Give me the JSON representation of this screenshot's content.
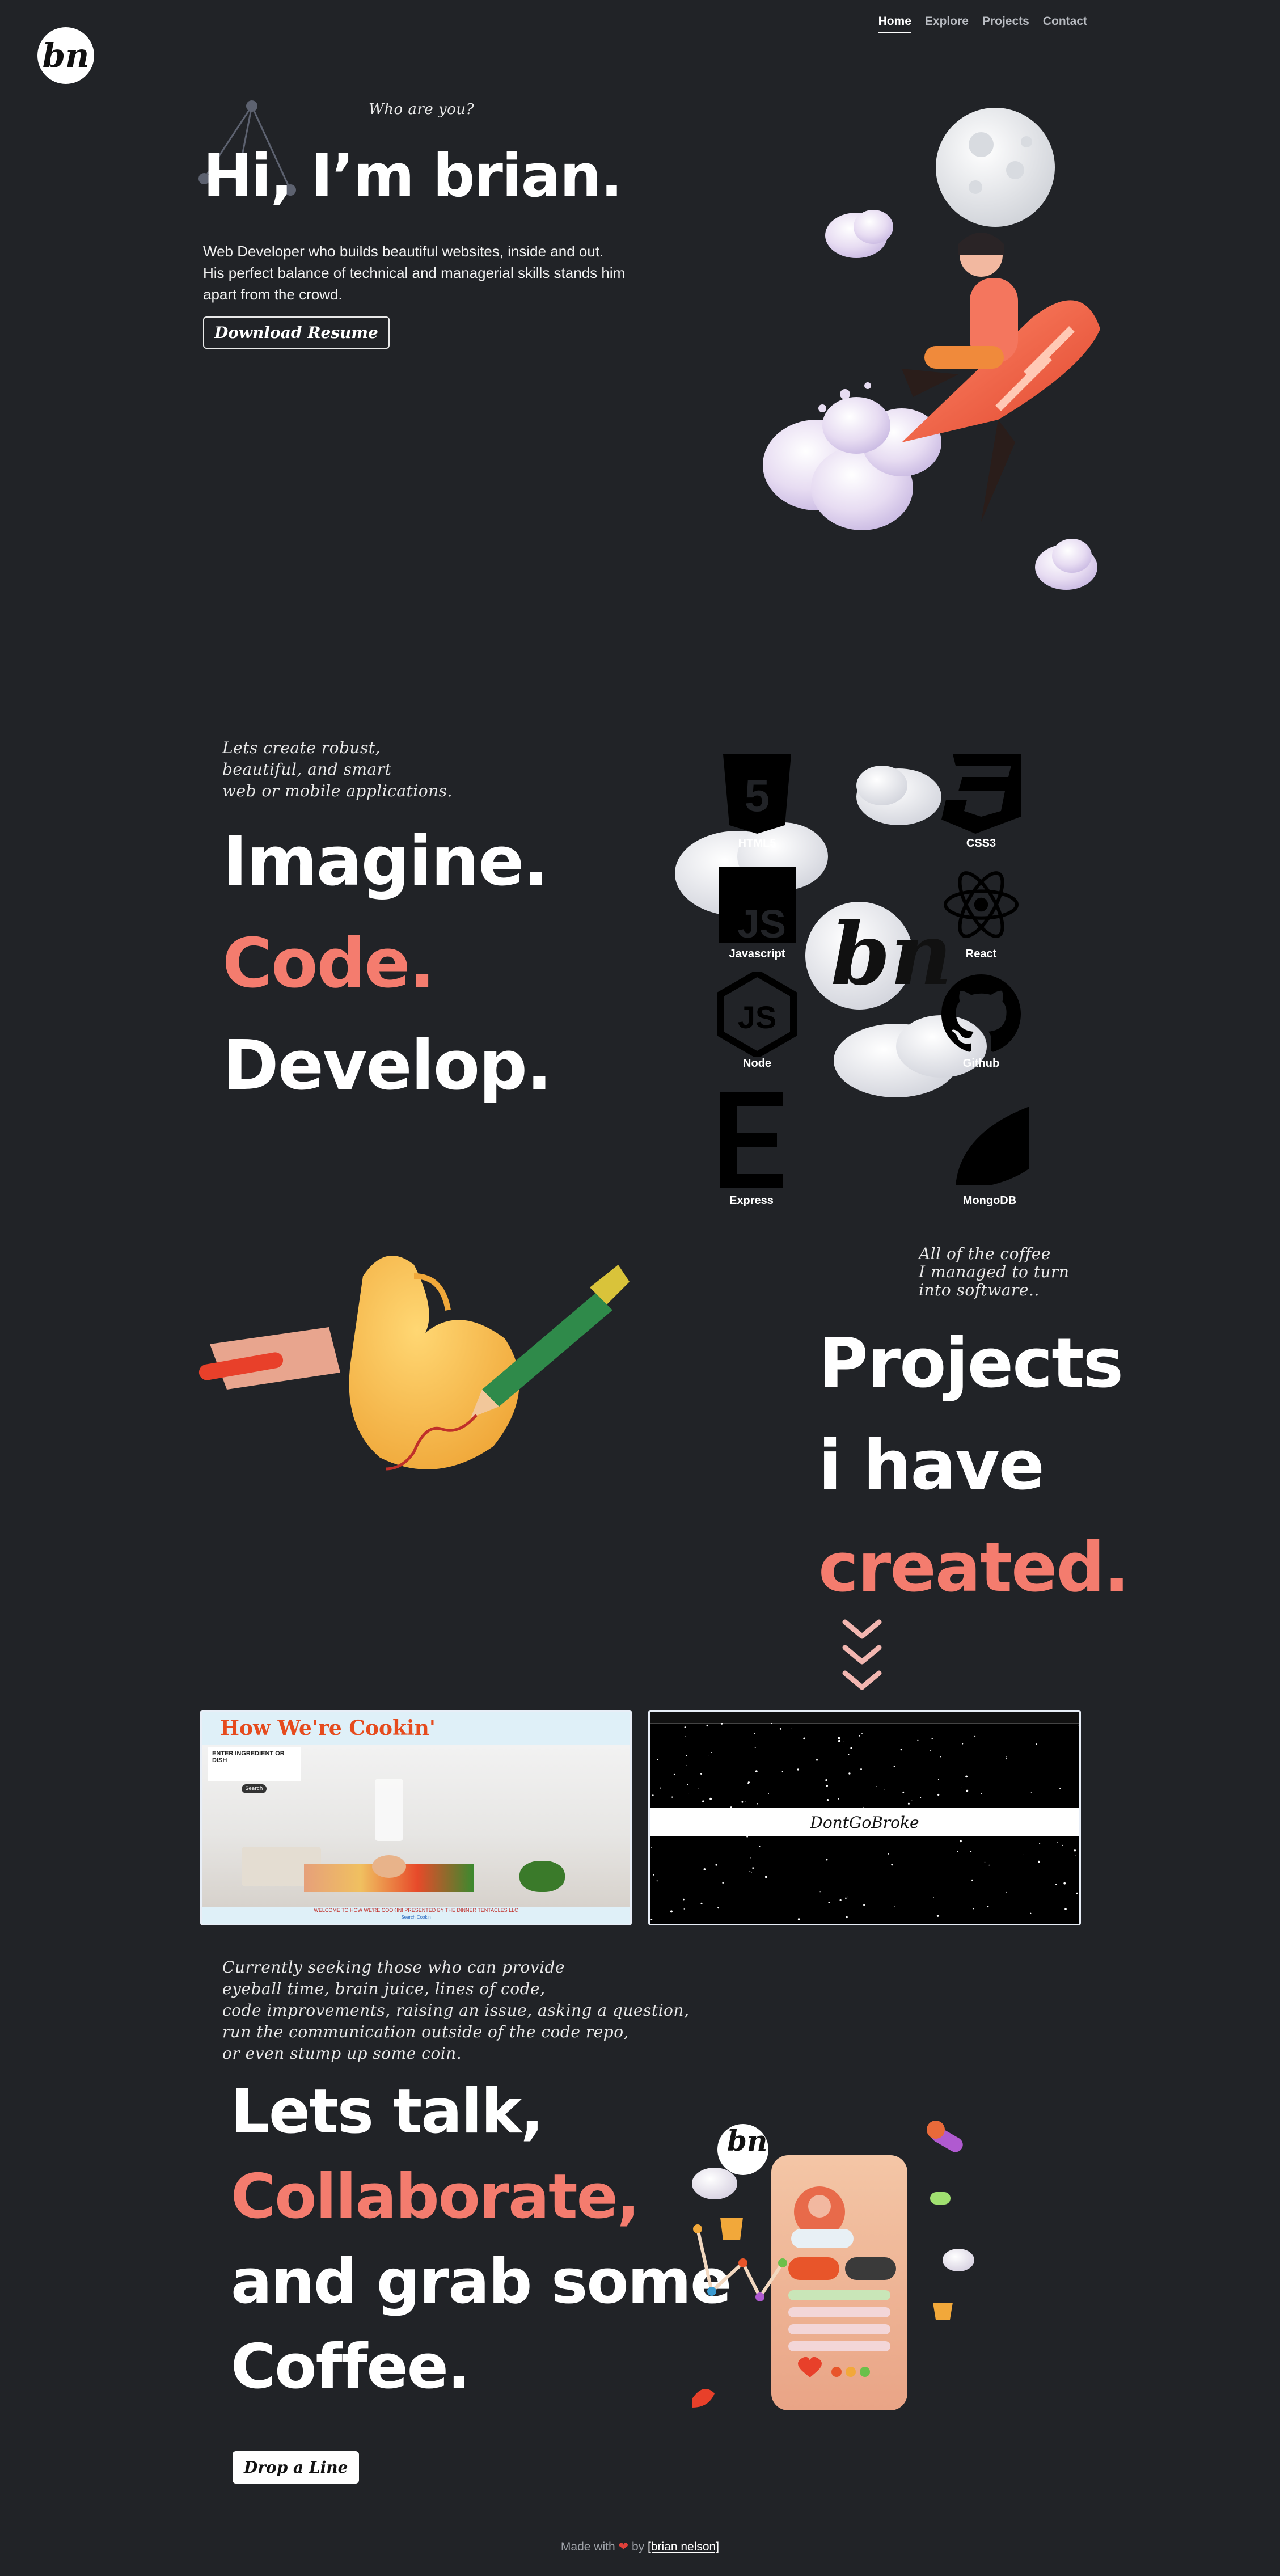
{
  "brand": {
    "logo_text": "bn"
  },
  "nav": {
    "items": [
      {
        "label": "Home",
        "active": true
      },
      {
        "label": "Explore",
        "active": false
      },
      {
        "label": "Projects",
        "active": false
      },
      {
        "label": "Contact",
        "active": false
      }
    ]
  },
  "hero": {
    "eyebrow": "Who are you?",
    "title": "Hi, I’m brian.",
    "desc_line1": "Web Developer who builds beautiful websites, inside and out.",
    "desc_line2": "His perfect balance of technical and managerial skills stands him",
    "desc_line3": "apart from the crowd.",
    "resume_button": "Download Resume"
  },
  "skills": {
    "eyebrow_line1": "Lets create robust,",
    "eyebrow_line2": "beautiful, and smart",
    "eyebrow_line3": "web or mobile applications.",
    "word1": "Imagine.",
    "word2": "Code.",
    "word3": "Develop.",
    "center_logo": "bn",
    "tech": [
      {
        "name": "HTML5",
        "icon": "html5-icon"
      },
      {
        "name": "CSS3",
        "icon": "css3-icon"
      },
      {
        "name": "Javascript",
        "icon": "javascript-icon"
      },
      {
        "name": "React",
        "icon": "react-icon"
      },
      {
        "name": "Node",
        "icon": "node-icon"
      },
      {
        "name": "Github",
        "icon": "github-icon"
      },
      {
        "name": "Express",
        "icon": "express-icon"
      },
      {
        "name": "MongoDB",
        "icon": "mongodb-icon"
      }
    ]
  },
  "projects": {
    "eyebrow_line1": "All of the coffee",
    "eyebrow_line2": "I managed to turn",
    "eyebrow_line3": "into software..",
    "title_line1": "Projects",
    "title_line2": "i have",
    "title_line3": "created.",
    "cards": [
      {
        "title": "How We're Cookin'",
        "input_label": "ENTER INGREDIENT OR DISH",
        "button": "Search",
        "footer": "WELCOME TO HOW WE'RE COOKIN! PRESENTED BY THE DINNER TENTACLES LLC",
        "footer_link": "Search Cookin"
      },
      {
        "title": "DontGoBroke"
      }
    ]
  },
  "contact": {
    "eyebrow_line1": "Currently seeking those who can provide",
    "eyebrow_line2": "eyeball time, brain juice, lines of code,",
    "eyebrow_line3": "code improvements, raising an issue, asking a question,",
    "eyebrow_line4": "run the communication outside of the code repo,",
    "eyebrow_line5": "or even stump up some coin.",
    "line1": "Lets talk,",
    "line2": "Collaborate,",
    "line3": "and grab some",
    "line4": "Coffee.",
    "button": "Drop a Line",
    "badge_logo": "bn"
  },
  "footer": {
    "made_with": "Made with",
    "by": "by",
    "author_link": "[brian nelson]"
  },
  "colors": {
    "background": "#212327",
    "accent": "#f47c6e",
    "text": "#ffffff"
  }
}
